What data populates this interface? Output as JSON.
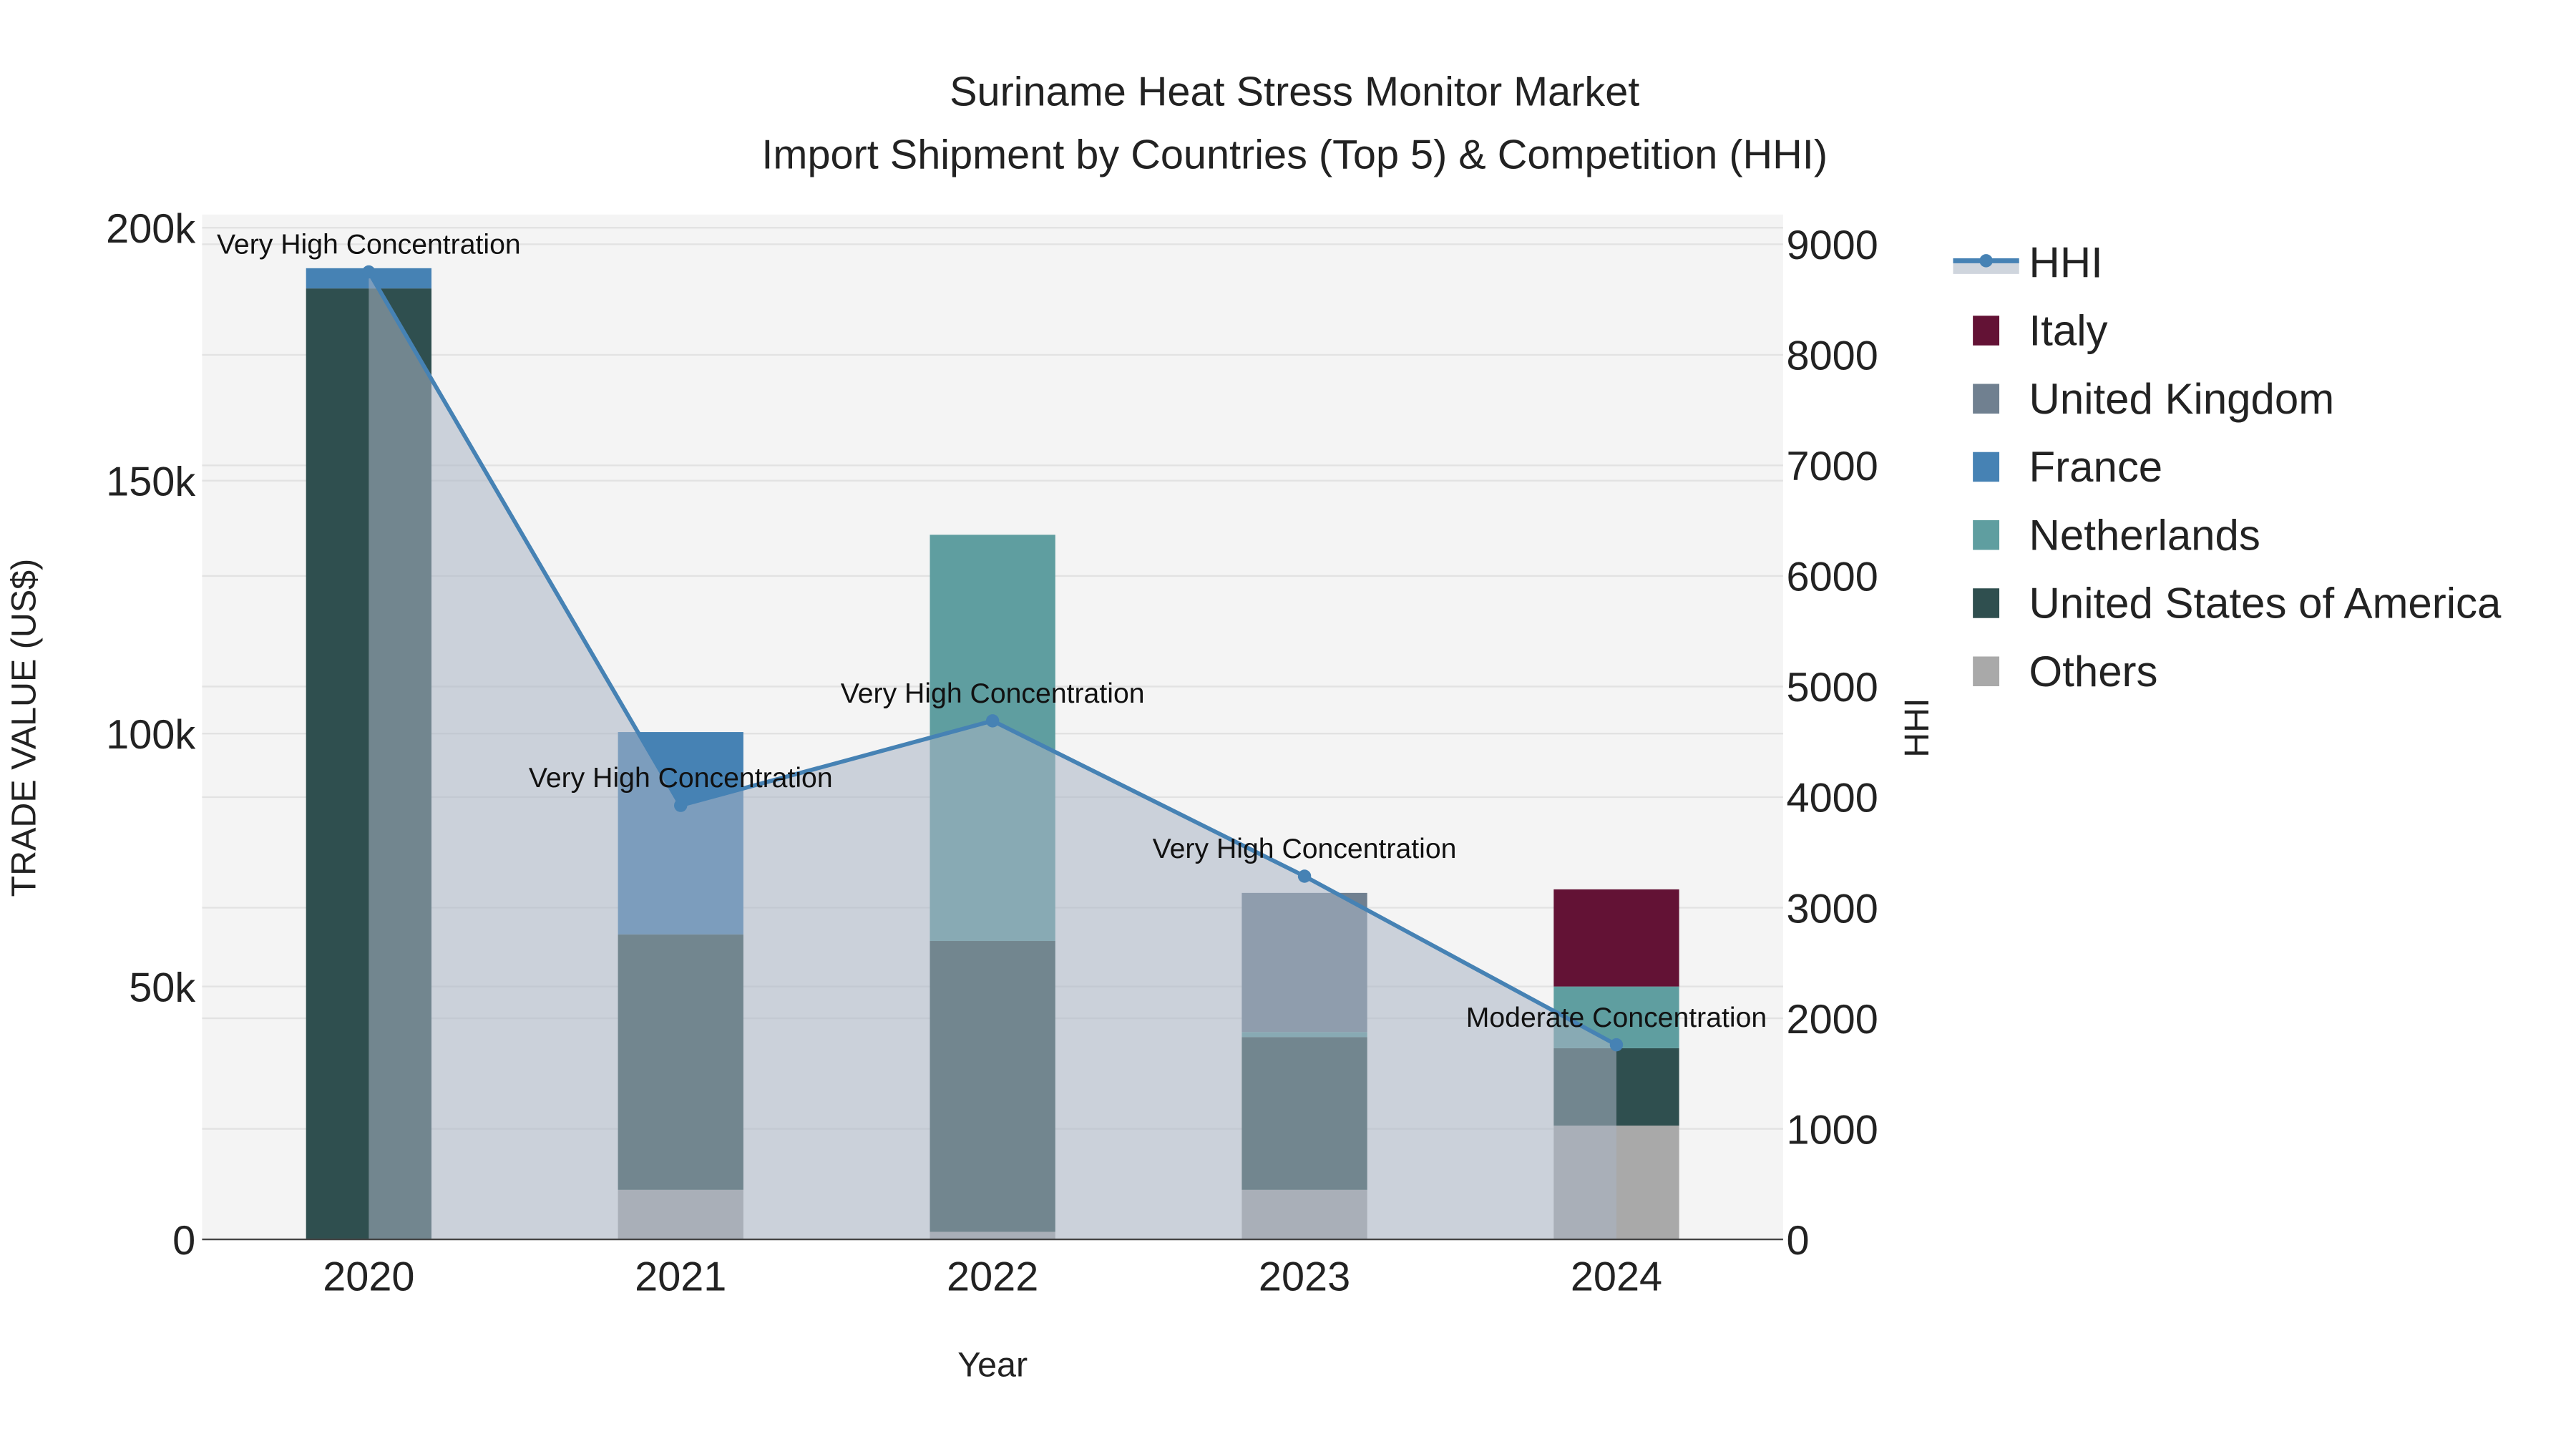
{
  "chart_data": {
    "type": "bar",
    "title": "Suriname Heat Stress Monitor Market",
    "subtitle": "Import Shipment by Countries (Top 5) & Competition (HHI)",
    "xlabel": "Year",
    "ylabel": "TRADE VALUE (US$)",
    "y2label": "HHI",
    "categories": [
      "2020",
      "2021",
      "2022",
      "2023",
      "2024"
    ],
    "ylim": [
      0,
      200000
    ],
    "y2lim": [
      0,
      9000
    ],
    "yticks": [
      {
        "v": 0,
        "label": "0"
      },
      {
        "v": 50000,
        "label": "50k"
      },
      {
        "v": 100000,
        "label": "100k"
      },
      {
        "v": 150000,
        "label": "150k"
      },
      {
        "v": 200000,
        "label": "200k"
      }
    ],
    "y2ticks": [
      0,
      1000,
      2000,
      3000,
      4000,
      5000,
      6000,
      7000,
      8000,
      9000
    ],
    "grid": true,
    "barmode": "stack",
    "legend_position": "right",
    "series": [
      {
        "name": "Others",
        "color": "#A9A9A9",
        "values": [
          0,
          9800,
          1500,
          9800,
          22500
        ]
      },
      {
        "name": "United States of America",
        "color": "#2F4F4F",
        "values": [
          188000,
          50500,
          57500,
          30200,
          15300
        ]
      },
      {
        "name": "Netherlands",
        "color": "#5F9EA0",
        "values": [
          0,
          0,
          80300,
          1000,
          12200
        ]
      },
      {
        "name": "France",
        "color": "#4682B4",
        "values": [
          4000,
          40000,
          0,
          0,
          0
        ]
      },
      {
        "name": "United Kingdom",
        "color": "#708090",
        "values": [
          0,
          0,
          0,
          27500,
          0
        ]
      },
      {
        "name": "Italy",
        "color": "#631235",
        "values": [
          0,
          0,
          0,
          0,
          19200
        ]
      }
    ],
    "hhi": {
      "name": "HHI",
      "color": "#4682B4",
      "values": [
        8750,
        3925,
        4690,
        3285,
        1760
      ],
      "annotations": [
        "Very High Concentration",
        "Very High Concentration",
        "Very High Concentration",
        "Very High Concentration",
        "Moderate Concentration"
      ]
    },
    "legend_order": [
      "HHI",
      "Italy",
      "United Kingdom",
      "France",
      "Netherlands",
      "United States of America",
      "Others"
    ]
  }
}
